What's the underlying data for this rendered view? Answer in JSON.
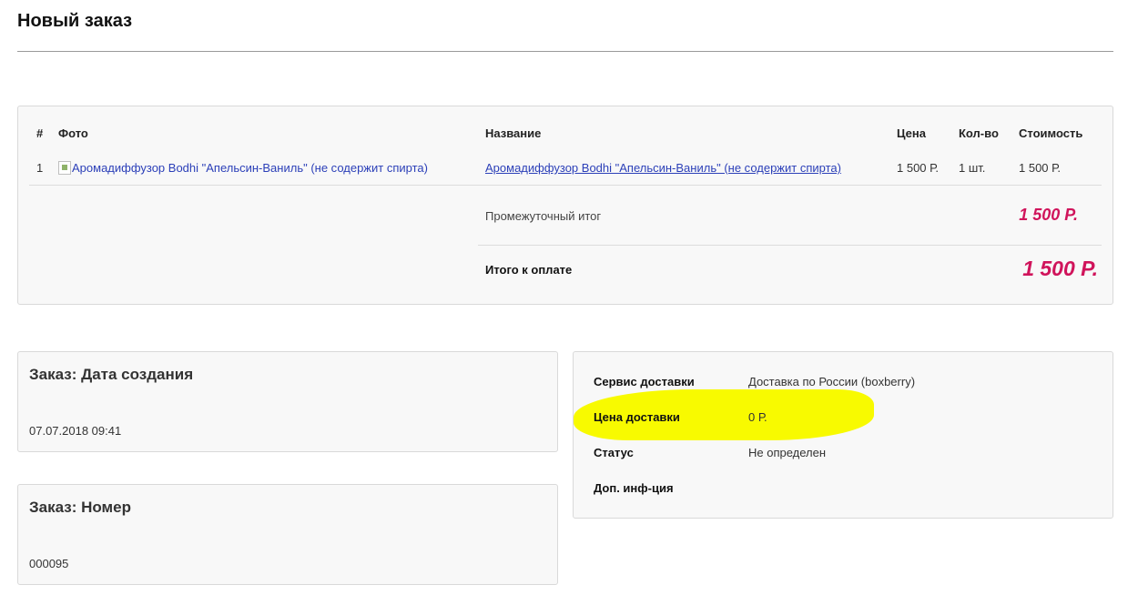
{
  "page": {
    "title": "Новый заказ"
  },
  "order_table": {
    "headers": {
      "num": "#",
      "photo": "Фото",
      "name": "Название",
      "price": "Цена",
      "qty": "Кол-во",
      "cost": "Стоимость"
    },
    "rows": [
      {
        "num": "1",
        "photo_alt": "Аромадиффузор Bodhi \"Апельсин-Ваниль\" (не содержит спирта)",
        "name": "Аромадиффузор Bodhi \"Апельсин-Ваниль\" (не содержит спирта)",
        "price": "1 500 Р.",
        "qty": "1 шт.",
        "cost": "1 500 Р."
      }
    ],
    "subtotal_label": "Промежуточный итог",
    "subtotal_value": "1 500 Р.",
    "total_label": "Итого к оплате",
    "total_value": "1 500 Р."
  },
  "created": {
    "heading": "Заказ: Дата создания",
    "value": "07.07.2018 09:41"
  },
  "number": {
    "heading": "Заказ: Номер",
    "value": "000095"
  },
  "delivery": {
    "service_label": "Сервис доставки",
    "service_value": "Доставка по России (boxberry)",
    "price_label": "Цена доставки",
    "price_value": "0 Р.",
    "status_label": "Статус",
    "status_value": "Не определен",
    "extra_label": "Доп. инф-ция",
    "extra_value": ""
  },
  "colors": {
    "accent": "#d0145b",
    "link": "#2b3fb8",
    "highlight": "#f8fa00"
  }
}
